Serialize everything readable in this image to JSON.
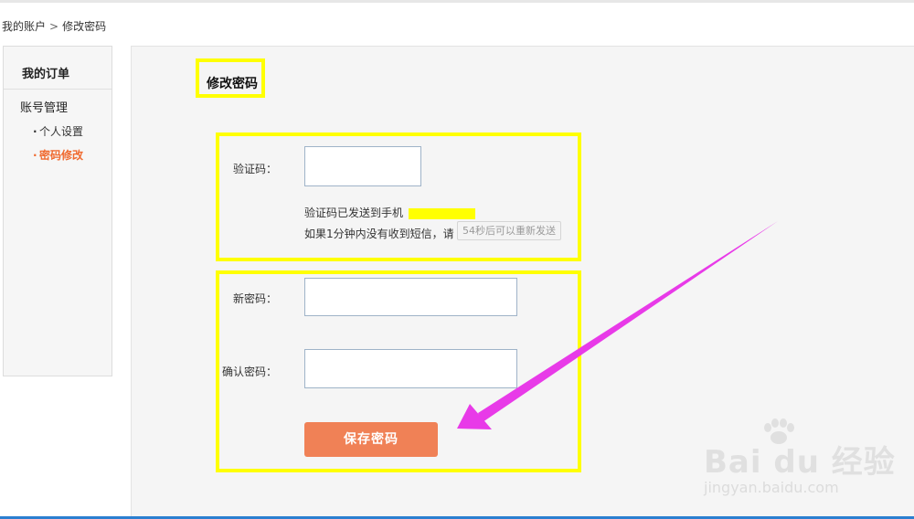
{
  "breadcrumb": {
    "root": "我的账户",
    "separator": ">",
    "current": "修改密码"
  },
  "sidebar": {
    "title": "我的订单",
    "group": "账号管理",
    "items": [
      {
        "label": "个人设置",
        "active": false
      },
      {
        "label": "密码修改",
        "active": true
      }
    ]
  },
  "main": {
    "title": "修改密码",
    "verify": {
      "label": "验证码：",
      "value": "",
      "notice_line1": "验证码已发送到手机",
      "notice_line2": "如果1分钟内没有收到短信，请",
      "resend_label": "54秒后可以重新发送"
    },
    "new_password": {
      "label": "新密码：",
      "value": ""
    },
    "confirm_password": {
      "label": "确认密码：",
      "value": ""
    },
    "save_label": "保存密码"
  },
  "watermark": {
    "brand": "Bai du 经验",
    "url": "jingyan.baidu.com"
  },
  "colors": {
    "accent": "#f06a2f",
    "button": "#f08156",
    "highlight": "#ffff00",
    "arrow": "#e83ae8",
    "bottom_bar": "#2b7fd0"
  }
}
